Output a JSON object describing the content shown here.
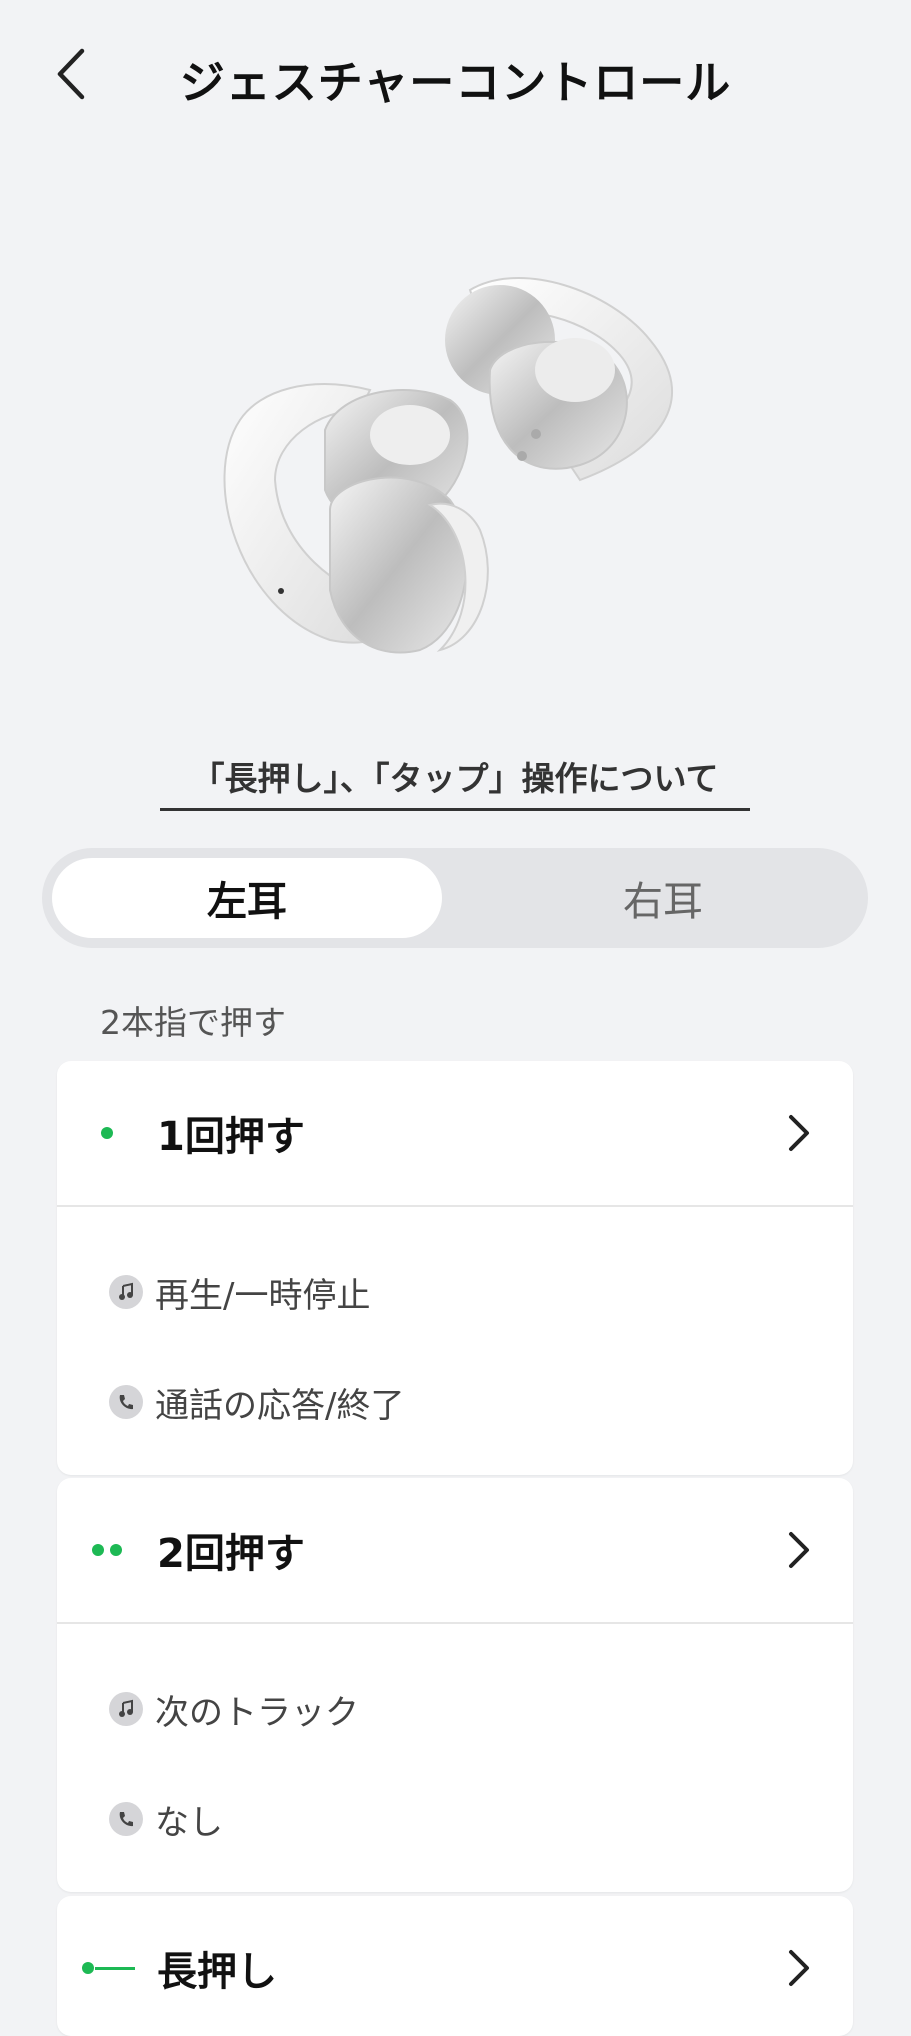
{
  "header": {
    "title": "ジェスチャーコントロール"
  },
  "gesture_info_link": "「長押し」、「タップ」操作について",
  "ear_tabs": {
    "left": "左耳",
    "right": "右耳",
    "selected": "left"
  },
  "section_label": "2本指で押す",
  "cards": [
    {
      "title": "1回押す",
      "indicator": "single-dot",
      "actions": [
        {
          "icon": "music-note-icon",
          "label": "再生/一時停止"
        },
        {
          "icon": "phone-icon",
          "label": "通話の応答/終了"
        }
      ]
    },
    {
      "title": "2回押す",
      "indicator": "double-dot",
      "actions": [
        {
          "icon": "music-note-icon",
          "label": "次のトラック"
        },
        {
          "icon": "phone-icon",
          "label": "なし"
        }
      ]
    },
    {
      "title": "長押し",
      "indicator": "dot-line"
    }
  ],
  "colors": {
    "accent": "#1db954",
    "background": "#f2f3f5",
    "card": "#ffffff"
  }
}
